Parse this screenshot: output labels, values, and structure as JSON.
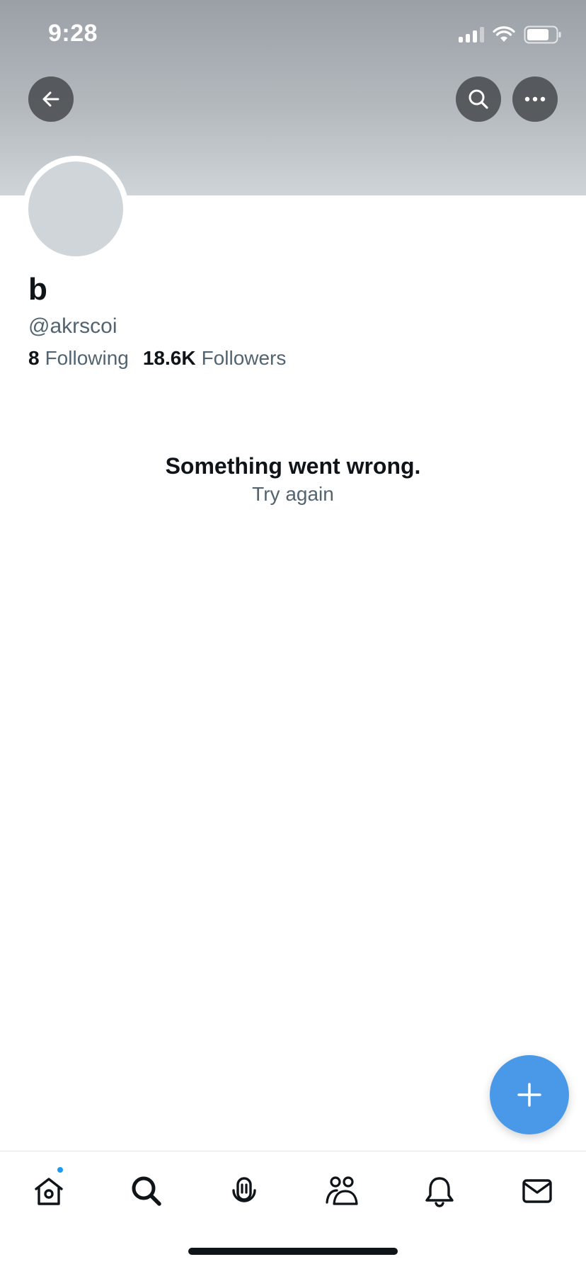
{
  "status_bar": {
    "time": "9:28"
  },
  "header": {
    "back_icon": "arrow-left-icon",
    "search_icon": "search-icon",
    "more_icon": "more-horizontal-icon"
  },
  "profile": {
    "display_name": "b",
    "handle": "@akrscoi",
    "following_count": "8",
    "following_label": "Following",
    "followers_count": "18.6K",
    "followers_label": "Followers"
  },
  "error": {
    "title": "Something went wrong.",
    "retry": "Try again"
  },
  "fab": {
    "icon": "plus-icon",
    "color": "#4a99e9"
  },
  "tab_bar": {
    "items": [
      {
        "name": "home",
        "icon": "home-icon",
        "has_notification_dot": true
      },
      {
        "name": "search",
        "icon": "search-icon"
      },
      {
        "name": "spaces",
        "icon": "microphone-icon"
      },
      {
        "name": "communities",
        "icon": "people-icon"
      },
      {
        "name": "notifications",
        "icon": "bell-icon"
      },
      {
        "name": "messages",
        "icon": "envelope-icon"
      }
    ],
    "accent_color": "#1d9bf0"
  }
}
